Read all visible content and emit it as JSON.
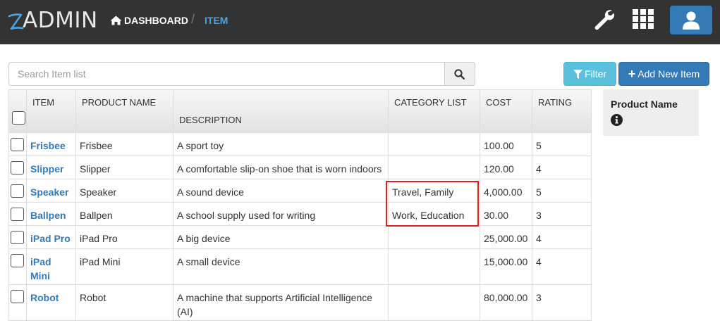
{
  "app": {
    "logo_text": "ADMIN",
    "breadcrumb": {
      "home": "DASHBOARD",
      "separator": "/",
      "current": "ITEM"
    }
  },
  "icons": {
    "home": "home-icon",
    "wrench": "wrench-icon",
    "apps": "grid-icon",
    "user": "user-icon",
    "search": "search-icon",
    "filter": "filter-icon",
    "info": "info-icon"
  },
  "colors": {
    "topbar": "#333333",
    "primary": "#337ab7",
    "info": "#5bc0de",
    "link": "#337ab7",
    "breadcrumb_active": "#4aa3df",
    "highlight": "#e02020"
  },
  "search": {
    "placeholder": "Search Item list",
    "value": ""
  },
  "toolbar": {
    "filter_label": "Filter",
    "add_label": "Add New Item"
  },
  "table": {
    "columns": [
      "ITEM",
      "PRODUCT NAME",
      "DESCRIPTION",
      "CATEGORY LIST",
      "COST",
      "RATING"
    ],
    "rows": [
      {
        "item": "Frisbee",
        "product_name": "Frisbee",
        "description": "A sport toy",
        "category": "",
        "cost": "100.00",
        "rating": "5"
      },
      {
        "item": "Slipper",
        "product_name": "Slipper",
        "description": "A comfortable slip-on shoe that is worn indoors",
        "category": "",
        "cost": "120.00",
        "rating": "4"
      },
      {
        "item": "Speaker",
        "product_name": "Speaker",
        "description": "A sound device",
        "category": "Travel, Family",
        "cost": "4,000.00",
        "rating": "5"
      },
      {
        "item": "Ballpen",
        "product_name": "Ballpen",
        "description": "A school supply used for writing",
        "category": "Work, Education",
        "cost": "30.00",
        "rating": "3"
      },
      {
        "item": "iPad Pro",
        "product_name": "iPad Pro",
        "description": "A big device",
        "category": "",
        "cost": "25,000.00",
        "rating": "4"
      },
      {
        "item": "iPad Mini",
        "product_name": "iPad Mini",
        "description": "A small device",
        "category": "",
        "cost": "15,000.00",
        "rating": "4"
      },
      {
        "item": "Robot",
        "product_name": "Robot",
        "description": "A machine that supports Artificial Intelligence (AI)",
        "category": "",
        "cost": "80,000.00",
        "rating": "3"
      }
    ]
  },
  "side_panel": {
    "title": "Product Name"
  }
}
